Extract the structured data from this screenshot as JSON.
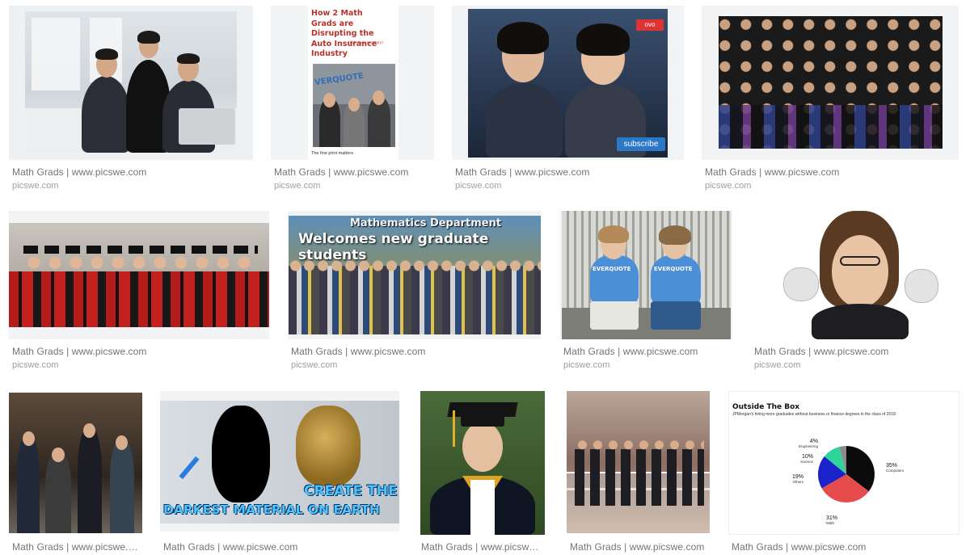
{
  "results": [
    {
      "title": "Math Grads | www.picswe.com",
      "source": "picswe.com"
    },
    {
      "title": "Math Grads | www.picswe.com",
      "source": "picswe.com",
      "image_text": {
        "headline": "How 2 Math Grads are Disrupting the Auto Insurance Industry",
        "aside": "(With their secretary)",
        "footer": "The fine print matters",
        "sign": "VERQUOTE"
      }
    },
    {
      "title": "Math Grads | www.picswe.com",
      "source": "picswe.com",
      "image_text": {
        "subscribe": "subscribe",
        "logo": "ovo"
      }
    },
    {
      "title": "Math Grads | www.picswe.com",
      "source": "picswe.com"
    },
    {
      "title": "Math Grads | www.picswe.com",
      "source": "picswe.com"
    },
    {
      "title": "Math Grads | www.picswe.com",
      "source": "picswe.com",
      "image_text": {
        "dept": "Mathematics Department",
        "headline": "Welcomes new graduate students"
      }
    },
    {
      "title": "Math Grads | www.picswe.com",
      "source": "picswe.com",
      "image_text": {
        "shirt1": "EVERQUOTE",
        "shirt2": "EVERQUOTE"
      }
    },
    {
      "title": "Math Grads | www.picswe.com",
      "source": "picswe.com"
    },
    {
      "title": "Math Grads | www.picswe.c...",
      "source": ""
    },
    {
      "title": "Math Grads | www.picswe.com",
      "source": "",
      "image_text": {
        "line1": "CREATE THE",
        "line2": "DARKEST MATERIAL ON EARTH"
      }
    },
    {
      "title": "Math Grads | www.picswe.c...",
      "source": ""
    },
    {
      "title": "Math Grads | www.picswe.com",
      "source": ""
    },
    {
      "title": "Math Grads | www.picswe.com",
      "source": "",
      "image_text": {
        "title": "Outside The Box",
        "subtitle": "JPMorgan's hiring more graduates without business or finance degrees in the class of 2018",
        "labels": [
          {
            "pct": "4%",
            "name": "Engineering"
          },
          {
            "pct": "10%",
            "name": "Science"
          },
          {
            "pct": "19%",
            "name": "Others"
          },
          {
            "pct": "35%",
            "name": "Computers"
          },
          {
            "pct": "31%",
            "name": "Math"
          }
        ]
      }
    }
  ],
  "colors": {
    "caption": "#70757a",
    "source": "#9aa0a6",
    "pie_computers": "#0b0b0b",
    "pie_math": "#e74c4c",
    "pie_others": "#1c22c9",
    "pie_science": "#2fd49b",
    "pie_engineering": "#8b8b8b"
  },
  "chart_data": {
    "type": "pie",
    "title": "Outside The Box",
    "subtitle": "JPMorgan's hiring more graduates without business or finance degrees in the class of 2018",
    "categories": [
      "Computers",
      "Math",
      "Others",
      "Science",
      "Engineering"
    ],
    "values": [
      35,
      31,
      19,
      10,
      4
    ]
  }
}
